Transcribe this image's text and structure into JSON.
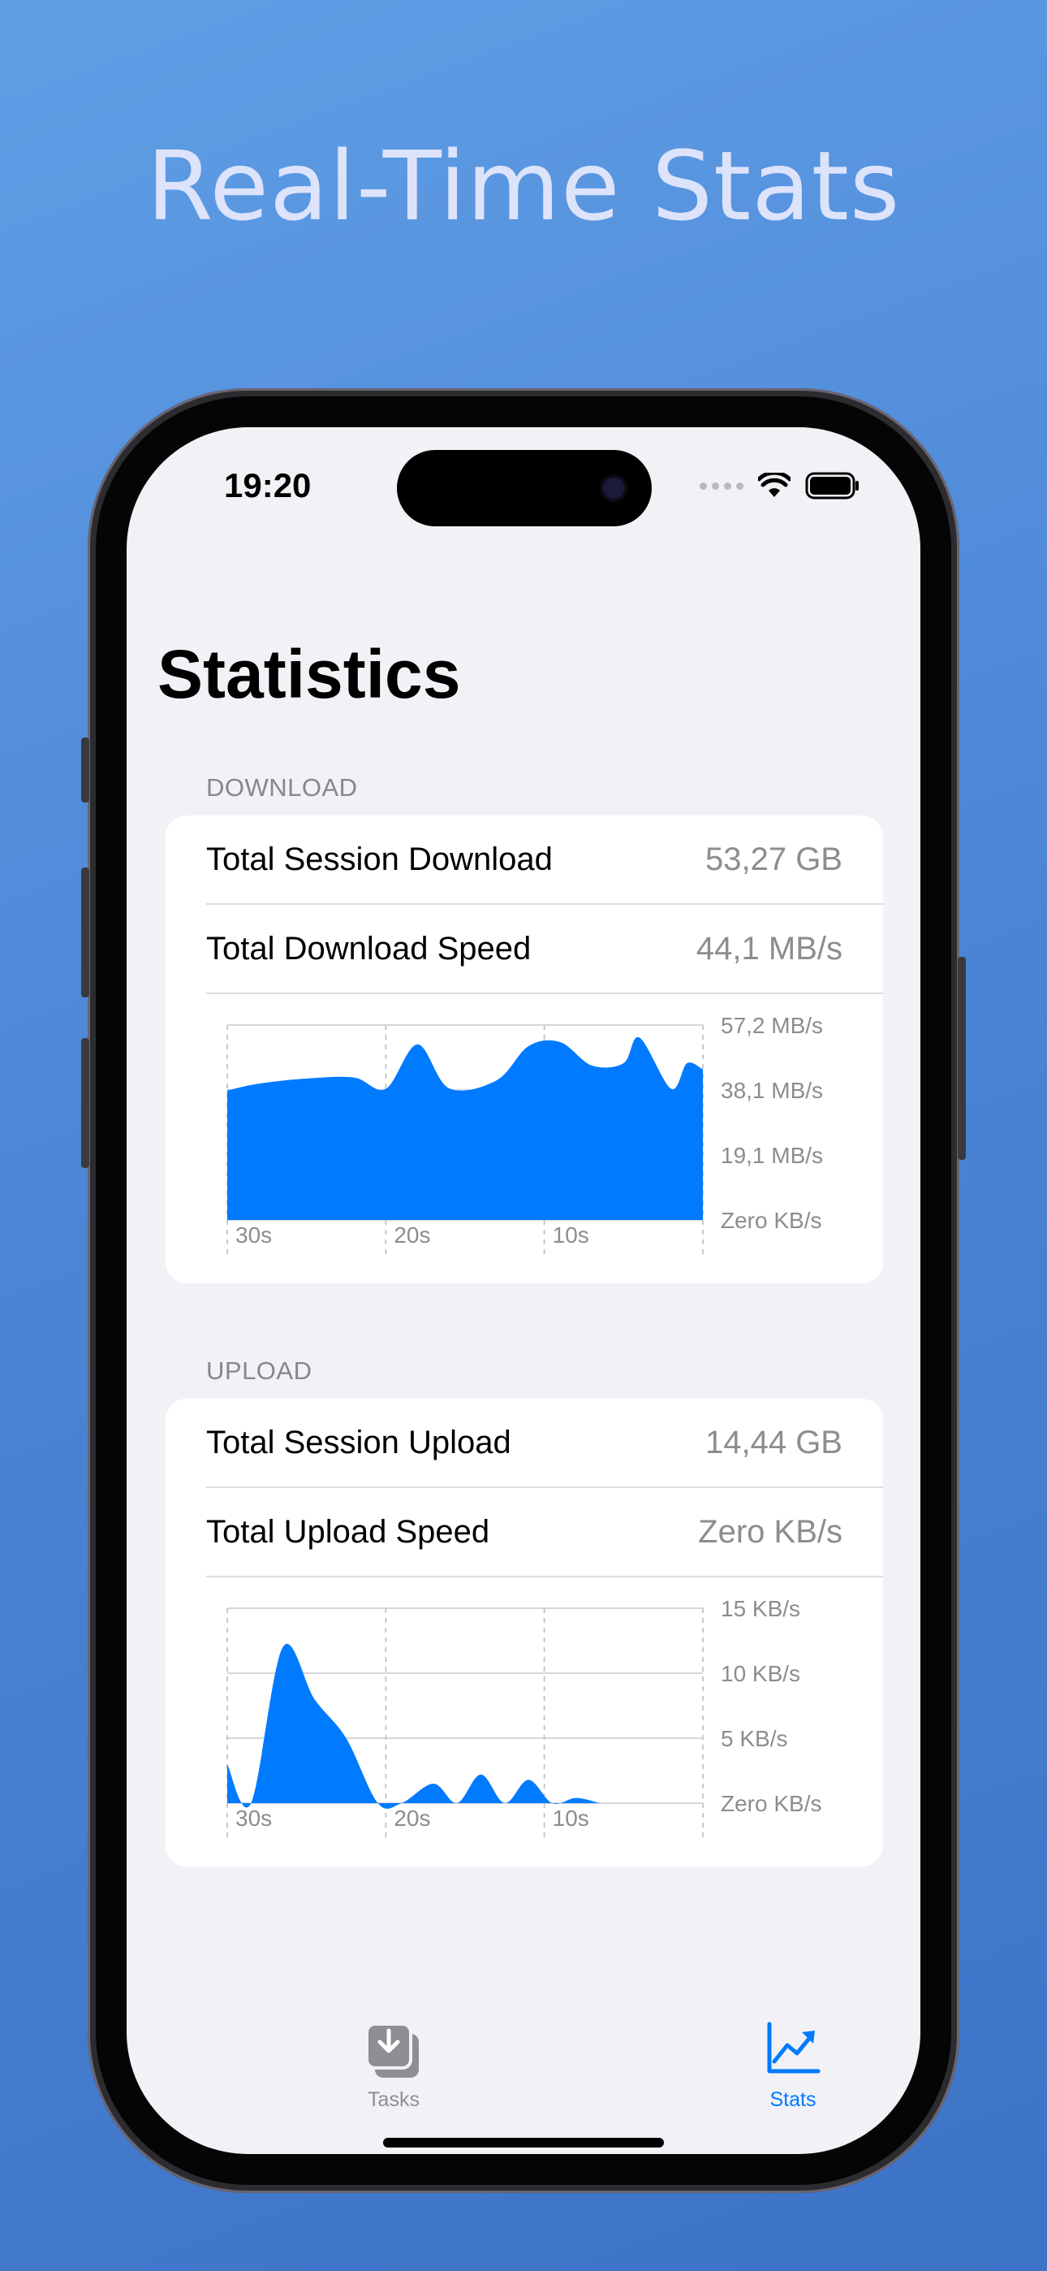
{
  "headline": "Real-Time Stats",
  "status_bar": {
    "time": "19:20"
  },
  "page_title": "Statistics",
  "download": {
    "header": "DOWNLOAD",
    "rows": [
      {
        "label": "Total Session Download",
        "value": "53,27 GB"
      },
      {
        "label": "Total Download Speed",
        "value": "44,1 MB/s"
      }
    ]
  },
  "upload": {
    "header": "UPLOAD",
    "rows": [
      {
        "label": "Total Session Upload",
        "value": "14,44 GB"
      },
      {
        "label": "Total Upload Speed",
        "value": "Zero KB/s"
      }
    ]
  },
  "tabs": [
    {
      "label": "Tasks",
      "icon": "tasks-download-icon",
      "selected": false
    },
    {
      "label": "Stats",
      "icon": "chart-trend-icon",
      "selected": true
    }
  ],
  "colors": {
    "accent": "#007aff",
    "secondary_text": "#8c8c91",
    "background": "#f2f1f6"
  },
  "chart_data": [
    {
      "type": "area",
      "series": [
        {
          "values": [
            38,
            40,
            41.5,
            41.8,
            38.5,
            51.5,
            38.6,
            41,
            51,
            52.2,
            45.3,
            46,
            53.5,
            38.5,
            46,
            44.2
          ]
        }
      ],
      "x": [
        30,
        28,
        25,
        22,
        20,
        18,
        16,
        13,
        11,
        9,
        7,
        5,
        4,
        2,
        1,
        0
      ],
      "x_ticks": [
        "30s",
        "20s",
        "10s"
      ],
      "y_ticks": [
        "57,2 MB/s",
        "38,1 MB/s",
        "19,1 MB/s",
        "Zero KB/s"
      ],
      "ylim": [
        0,
        57.2
      ],
      "grid": true
    },
    {
      "type": "area",
      "series": [
        {
          "values": [
            3,
            0,
            12,
            8,
            5,
            0,
            0,
            1.5,
            0,
            2.2,
            0,
            1.8,
            0,
            0.4,
            0
          ]
        }
      ],
      "x": [
        30,
        28.5,
        26.5,
        24.5,
        22.5,
        20.5,
        19,
        17,
        15.5,
        14,
        12.5,
        11,
        9.5,
        8,
        6.5
      ],
      "x_ticks": [
        "30s",
        "20s",
        "10s"
      ],
      "y_ticks": [
        "15 KB/s",
        "10 KB/s",
        "5 KB/s",
        "Zero KB/s"
      ],
      "ylim": [
        0,
        15
      ],
      "grid": true
    }
  ]
}
